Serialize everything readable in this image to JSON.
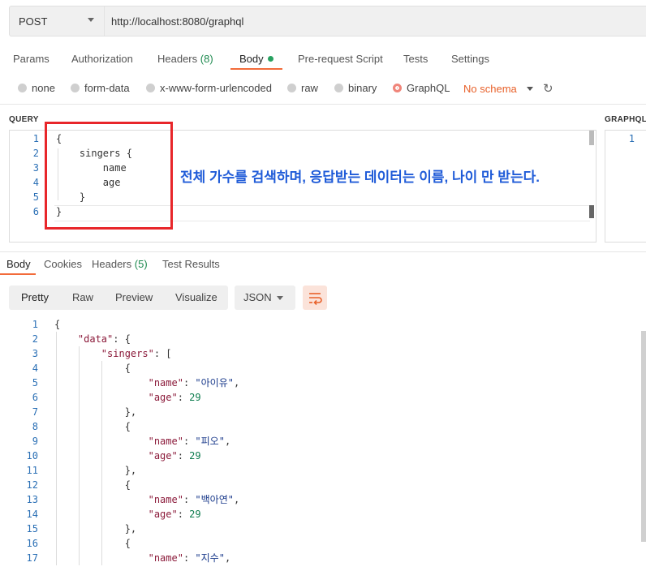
{
  "request": {
    "method": "POST",
    "url": "http://localhost:8080/graphql"
  },
  "request_tabs": {
    "params": "Params",
    "authorization": "Authorization",
    "headers": "Headers",
    "headers_count": "(8)",
    "body": "Body",
    "prerequest": "Pre-request Script",
    "tests": "Tests",
    "settings": "Settings"
  },
  "body_types": {
    "none": "none",
    "form_data": "form-data",
    "urlencoded": "x-www-form-urlencoded",
    "raw": "raw",
    "binary": "binary",
    "graphql": "GraphQL",
    "schema": "No schema"
  },
  "query_panel": {
    "label": "QUERY",
    "lines": [
      {
        "n": "1",
        "text": "{"
      },
      {
        "n": "2",
        "text": "    singers {"
      },
      {
        "n": "3",
        "text": "        name"
      },
      {
        "n": "4",
        "text": "        age"
      },
      {
        "n": "5",
        "text": "    }"
      },
      {
        "n": "6",
        "text": "}"
      }
    ]
  },
  "variables_panel": {
    "label": "GRAPHQL",
    "line": "1"
  },
  "annotation": "전체 가수를 검색하며, 응답받는 데이터는 이름, 나이 만 받는다.",
  "response_tabs": {
    "body": "Body",
    "cookies": "Cookies",
    "headers": "Headers",
    "headers_count": "(5)",
    "test_results": "Test Results"
  },
  "response_view": {
    "pretty": "Pretty",
    "raw": "Raw",
    "preview": "Preview",
    "visualize": "Visualize",
    "format": "JSON"
  },
  "response_lines": [
    {
      "n": "1",
      "html": "{"
    },
    {
      "n": "2",
      "html": "    <span class=\"key\">\"data\"</span>: {"
    },
    {
      "n": "3",
      "html": "        <span class=\"key\">\"singers\"</span>: ["
    },
    {
      "n": "4",
      "html": "            {"
    },
    {
      "n": "5",
      "html": "                <span class=\"key\">\"name\"</span>: <span class=\"str\">\"아이유\"</span>,"
    },
    {
      "n": "6",
      "html": "                <span class=\"key\">\"age\"</span>: <span class=\"numv\">29</span>"
    },
    {
      "n": "7",
      "html": "            },"
    },
    {
      "n": "8",
      "html": "            {"
    },
    {
      "n": "9",
      "html": "                <span class=\"key\">\"name\"</span>: <span class=\"str\">\"피오\"</span>,"
    },
    {
      "n": "10",
      "html": "                <span class=\"key\">\"age\"</span>: <span class=\"numv\">29</span>"
    },
    {
      "n": "11",
      "html": "            },"
    },
    {
      "n": "12",
      "html": "            {"
    },
    {
      "n": "13",
      "html": "                <span class=\"key\">\"name\"</span>: <span class=\"str\">\"백아연\"</span>,"
    },
    {
      "n": "14",
      "html": "                <span class=\"key\">\"age\"</span>: <span class=\"numv\">29</span>"
    },
    {
      "n": "15",
      "html": "            },"
    },
    {
      "n": "16",
      "html": "            {"
    },
    {
      "n": "17",
      "html": "                <span class=\"key\">\"name\"</span>: <span class=\"str\">\"지수\"</span>,"
    }
  ],
  "colors": {
    "accent": "#f26b3a",
    "annotation": "#1f5bd8",
    "highlight_box": "#e8262a"
  }
}
